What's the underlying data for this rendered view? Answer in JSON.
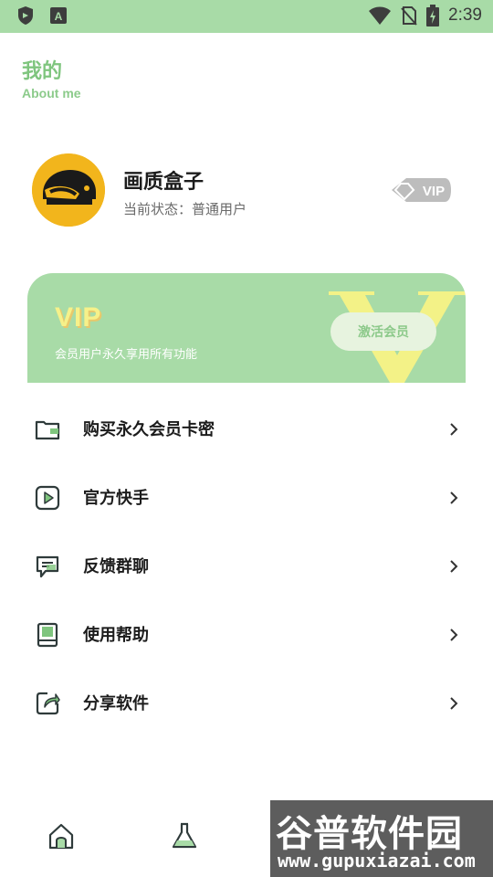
{
  "status_bar": {
    "time": "2:39",
    "icons": [
      "shield-icon",
      "a-icon",
      "wifi-icon",
      "no-sim-icon",
      "battery-charging-icon"
    ]
  },
  "header": {
    "title": "我的",
    "subtitle": "About me"
  },
  "profile": {
    "name": "画质盒子",
    "status": "当前状态：普通用户",
    "badge": "VIP"
  },
  "vip_card": {
    "title": "VIP",
    "description": "会员用户永久享用所有功能",
    "activate_label": "激活会员"
  },
  "menu": [
    {
      "label": "购买永久会员卡密",
      "icon": "wallet-icon"
    },
    {
      "label": "官方快手",
      "icon": "play-icon"
    },
    {
      "label": "反馈群聊",
      "icon": "chat-icon"
    },
    {
      "label": "使用帮助",
      "icon": "book-icon"
    },
    {
      "label": "分享软件",
      "icon": "share-icon"
    }
  ],
  "bottom_nav": [
    "home-icon",
    "flask-icon"
  ],
  "watermark": {
    "title": "谷普软件园",
    "url": "www.gupuxiazai.com"
  },
  "colors": {
    "accent": "#a8dba7",
    "title_green": "#7fc57e",
    "vip_yellow": "#f6f18a"
  }
}
